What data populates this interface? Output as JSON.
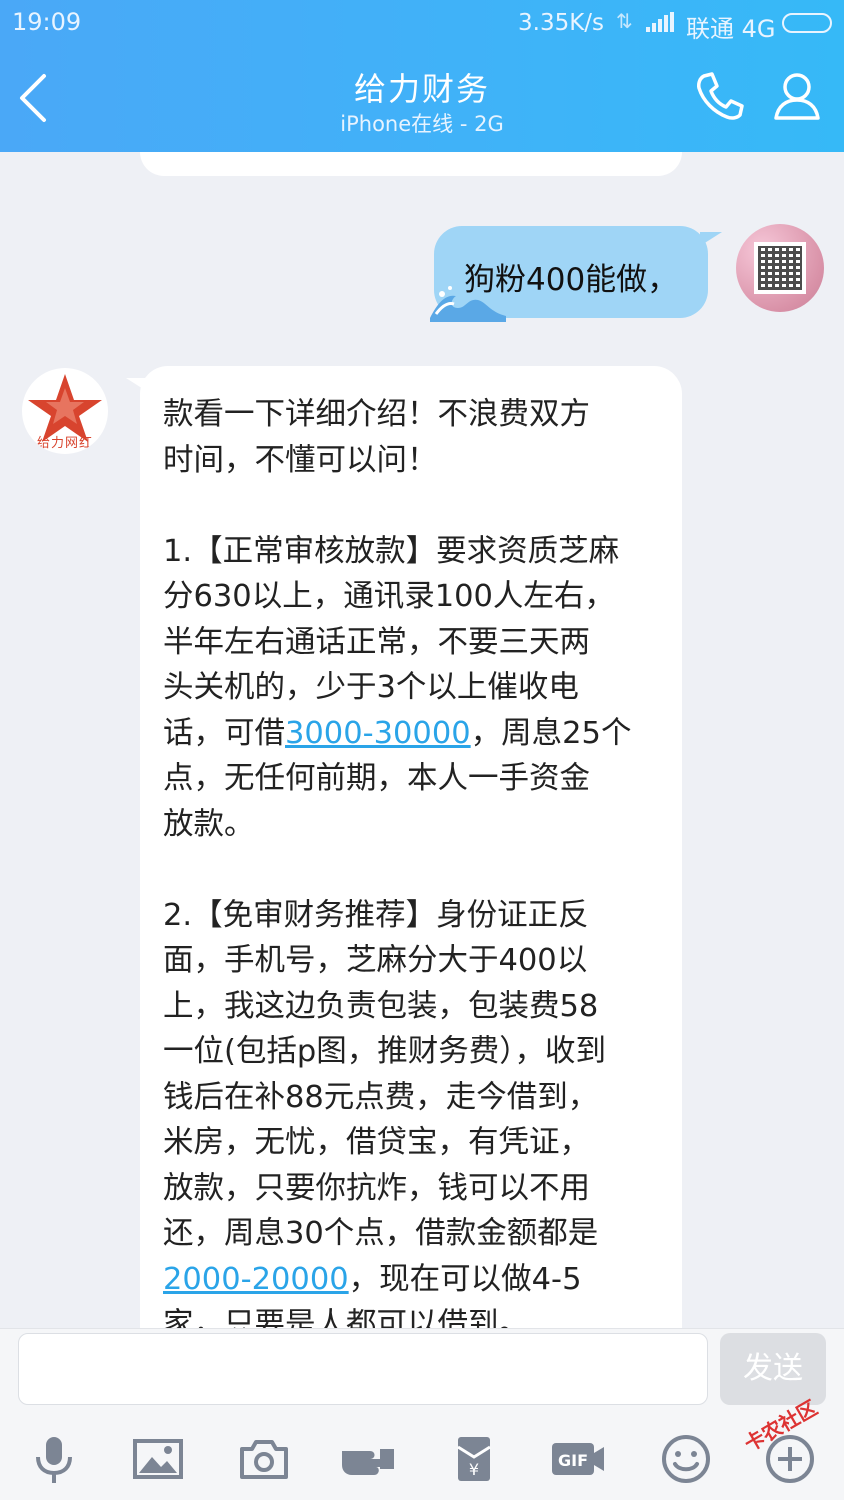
{
  "status_bar": {
    "time": "19:09",
    "network_speed": "3.35K/s",
    "carrier": "联通 4G"
  },
  "header": {
    "title": "给力财务",
    "subtitle": "iPhone在线 - 2G"
  },
  "messages": {
    "sent": {
      "text": "狗粉400能做，"
    },
    "received": {
      "avatar_label": "给力网红",
      "lines": [
        "款看一下详细介绍！不浪费双方",
        "时间，不懂可以问！"
      ],
      "item1": {
        "l1": "1.【正常审核放款】要求资质芝麻",
        "l2": "分630以上，通讯录100人左右，",
        "l3": "半年左右通话正常，不要三天两",
        "l4": "头关机的，少于3个以上催收电",
        "l5_pre": "话，可借",
        "l5_link": "3000-30000",
        "l5_post": "，周息25个",
        "l6": "点，无任何前期，本人一手资金",
        "l7": "放款。"
      },
      "item2": {
        "l1": "2.【免审财务推荐】身份证正反",
        "l2": "面，手机号，芝麻分大于400以",
        "l3": "上，我这边负责包装，包装费58",
        "l4": "一位(包括p图，推财务费），收到",
        "l5": "钱后在补88元点费，走今借到，",
        "l6": "米房，无忧，借贷宝，有凭证，",
        "l7": "放款，只要你抗炸，钱可以不用",
        "l8": "还，周息30个点，借款金额都是",
        "l9_link": "2000-20000",
        "l9_post": "，现在可以做4-5",
        "l10": "家，只要是人都可以借到。"
      }
    }
  },
  "input": {
    "placeholder": "",
    "send_label": "发送"
  },
  "toolbar": {
    "icons": [
      "microphone-icon",
      "image-icon",
      "camera-icon",
      "red-packet-hand-icon",
      "wallet-icon",
      "gif-icon",
      "emoji-icon",
      "plus-icon"
    ]
  },
  "watermark": "卡农社区",
  "colors": {
    "header": "#4aa8f7",
    "sent_bubble": "#9fd5f6",
    "link": "#2aa4e8",
    "background": "#eef0f5"
  }
}
